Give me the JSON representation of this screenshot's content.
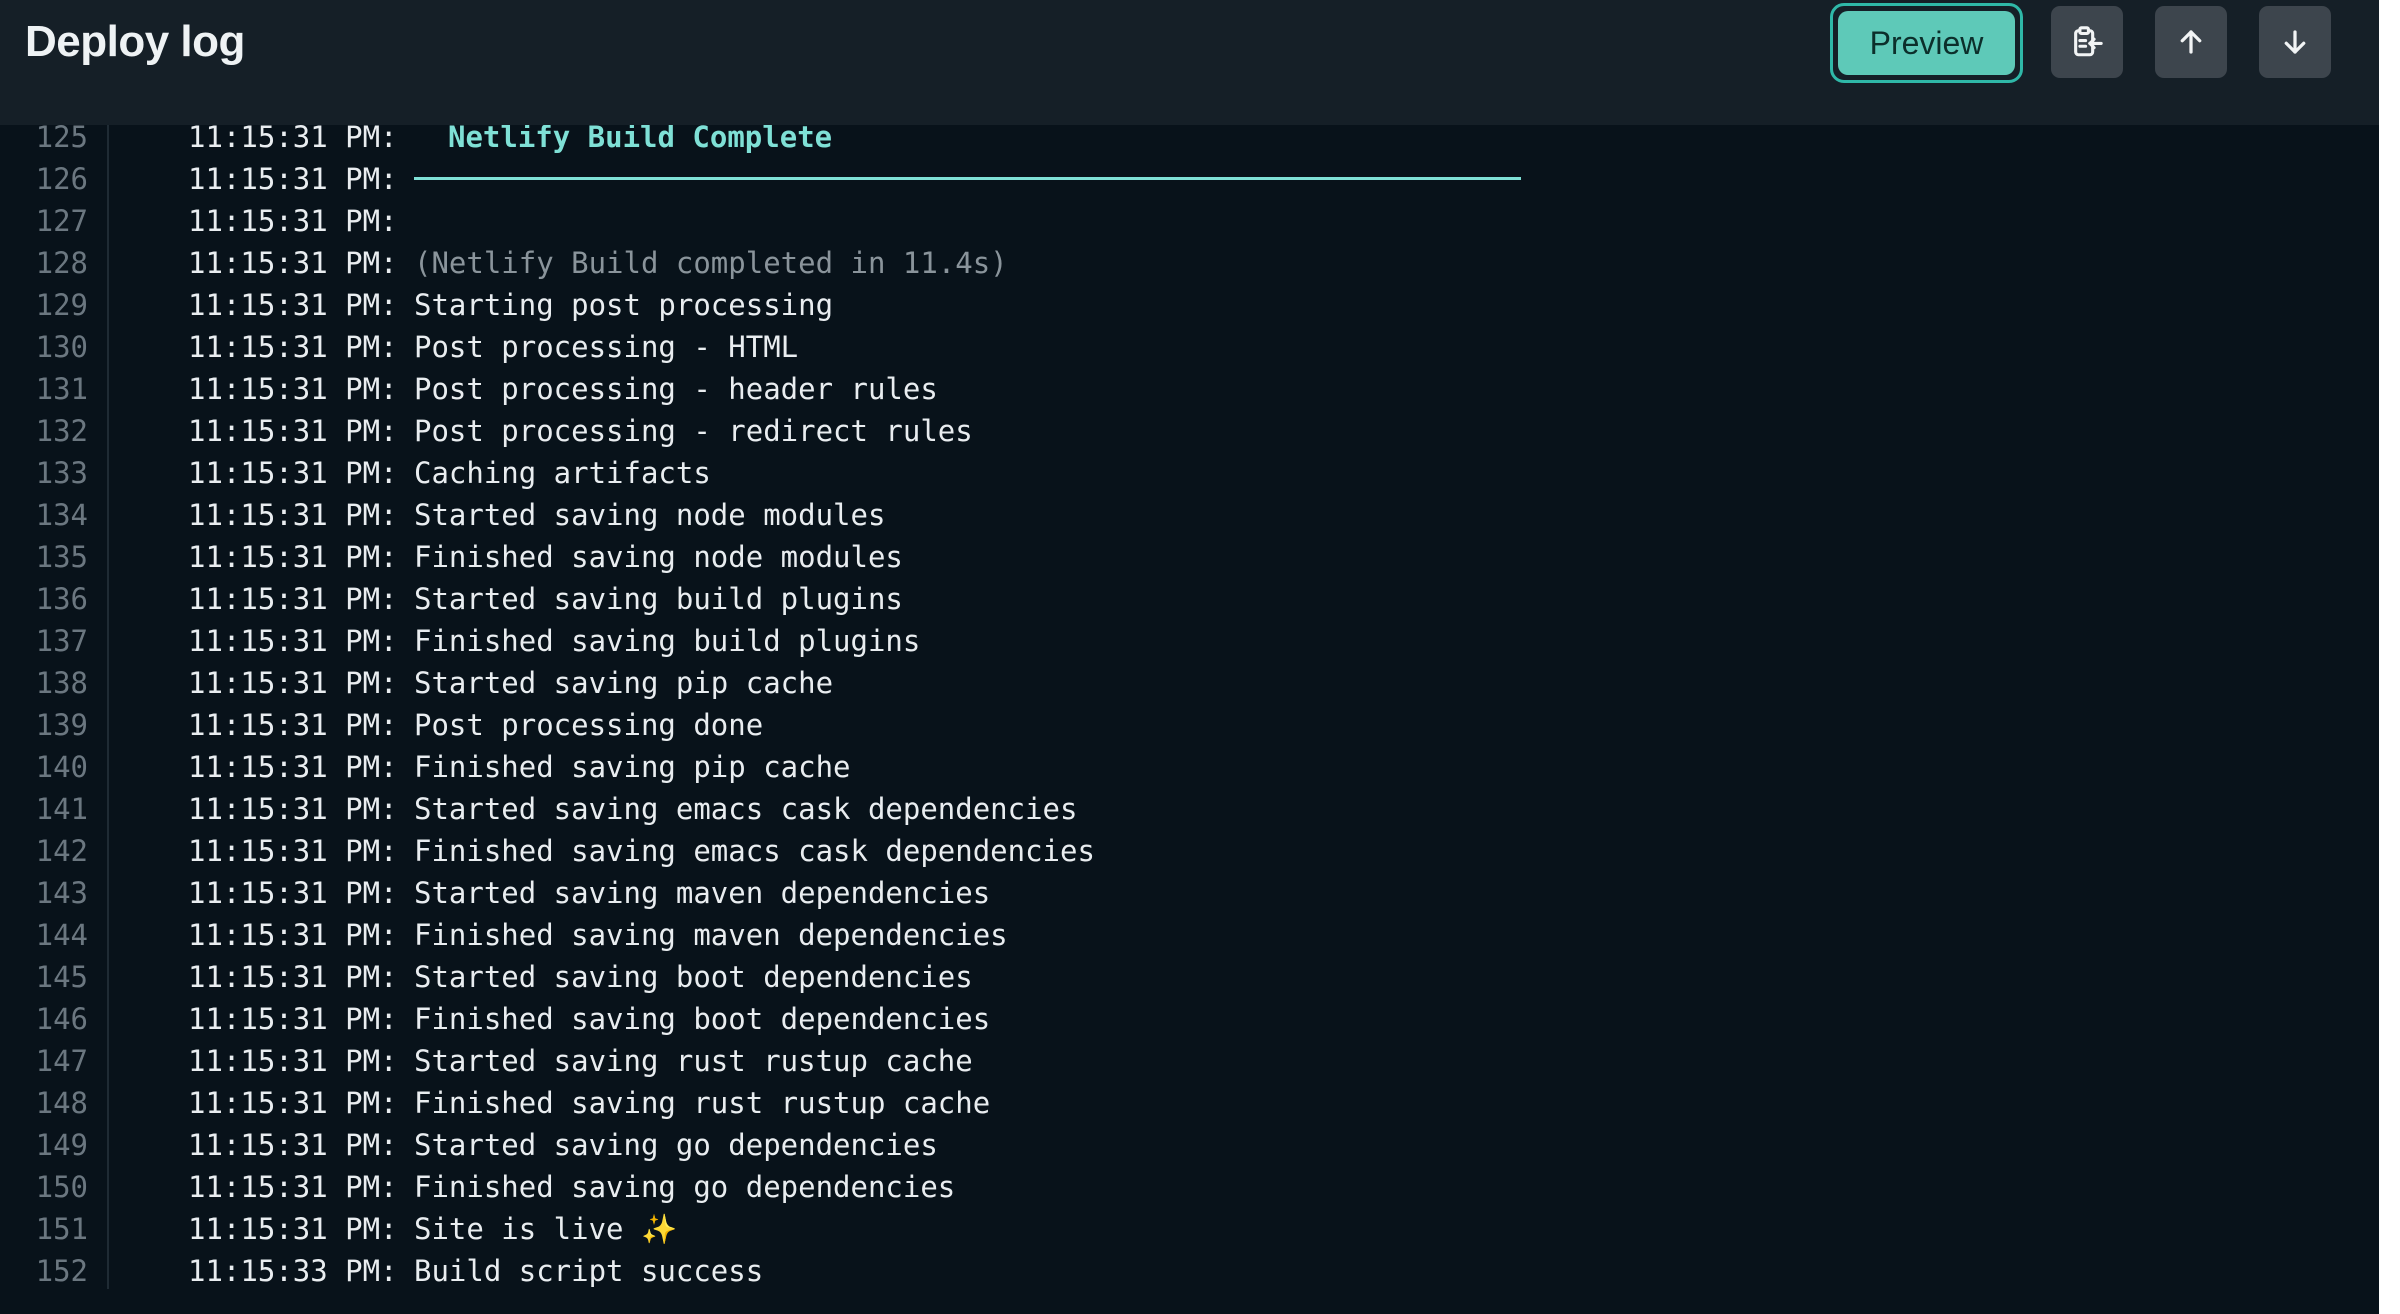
{
  "header": {
    "title": "Deploy log",
    "preview_label": "Preview",
    "copy_icon": "clipboard-copy-icon",
    "up_icon": "arrow-up-icon",
    "down_icon": "arrow-down-icon"
  },
  "colors": {
    "accent": "#5ec9b8",
    "heading": "#7fe0d6",
    "background": "#08121a",
    "header_bg": "#151f27"
  },
  "log": {
    "lines": [
      {
        "n": "125",
        "ts": "11:15:31 PM:",
        "msg": "Netlify Build Complete",
        "kind": "heading"
      },
      {
        "n": "126",
        "ts": "11:15:31 PM:",
        "msg": "",
        "kind": "rule"
      },
      {
        "n": "127",
        "ts": "11:15:31 PM:",
        "msg": "",
        "kind": "normal"
      },
      {
        "n": "128",
        "ts": "11:15:31 PM:",
        "msg": "(Netlify Build completed in 11.4s)",
        "kind": "dim"
      },
      {
        "n": "129",
        "ts": "11:15:31 PM:",
        "msg": "Starting post processing",
        "kind": "normal"
      },
      {
        "n": "130",
        "ts": "11:15:31 PM:",
        "msg": "Post processing - HTML",
        "kind": "normal"
      },
      {
        "n": "131",
        "ts": "11:15:31 PM:",
        "msg": "Post processing - header rules",
        "kind": "normal"
      },
      {
        "n": "132",
        "ts": "11:15:31 PM:",
        "msg": "Post processing - redirect rules",
        "kind": "normal"
      },
      {
        "n": "133",
        "ts": "11:15:31 PM:",
        "msg": "Caching artifacts",
        "kind": "normal"
      },
      {
        "n": "134",
        "ts": "11:15:31 PM:",
        "msg": "Started saving node modules",
        "kind": "normal"
      },
      {
        "n": "135",
        "ts": "11:15:31 PM:",
        "msg": "Finished saving node modules",
        "kind": "normal"
      },
      {
        "n": "136",
        "ts": "11:15:31 PM:",
        "msg": "Started saving build plugins",
        "kind": "normal"
      },
      {
        "n": "137",
        "ts": "11:15:31 PM:",
        "msg": "Finished saving build plugins",
        "kind": "normal"
      },
      {
        "n": "138",
        "ts": "11:15:31 PM:",
        "msg": "Started saving pip cache",
        "kind": "normal"
      },
      {
        "n": "139",
        "ts": "11:15:31 PM:",
        "msg": "Post processing done",
        "kind": "normal"
      },
      {
        "n": "140",
        "ts": "11:15:31 PM:",
        "msg": "Finished saving pip cache",
        "kind": "normal"
      },
      {
        "n": "141",
        "ts": "11:15:31 PM:",
        "msg": "Started saving emacs cask dependencies",
        "kind": "normal"
      },
      {
        "n": "142",
        "ts": "11:15:31 PM:",
        "msg": "Finished saving emacs cask dependencies",
        "kind": "normal"
      },
      {
        "n": "143",
        "ts": "11:15:31 PM:",
        "msg": "Started saving maven dependencies",
        "kind": "normal"
      },
      {
        "n": "144",
        "ts": "11:15:31 PM:",
        "msg": "Finished saving maven dependencies",
        "kind": "normal"
      },
      {
        "n": "145",
        "ts": "11:15:31 PM:",
        "msg": "Started saving boot dependencies",
        "kind": "normal"
      },
      {
        "n": "146",
        "ts": "11:15:31 PM:",
        "msg": "Finished saving boot dependencies",
        "kind": "normal"
      },
      {
        "n": "147",
        "ts": "11:15:31 PM:",
        "msg": "Started saving rust rustup cache",
        "kind": "normal"
      },
      {
        "n": "148",
        "ts": "11:15:31 PM:",
        "msg": "Finished saving rust rustup cache",
        "kind": "normal"
      },
      {
        "n": "149",
        "ts": "11:15:31 PM:",
        "msg": "Started saving go dependencies",
        "kind": "normal"
      },
      {
        "n": "150",
        "ts": "11:15:31 PM:",
        "msg": "Finished saving go dependencies",
        "kind": "normal"
      },
      {
        "n": "151",
        "ts": "11:15:31 PM:",
        "msg": "Site is live ✨",
        "kind": "normal"
      },
      {
        "n": "152",
        "ts": "11:15:33 PM:",
        "msg": "Build script success",
        "kind": "normal"
      }
    ]
  }
}
